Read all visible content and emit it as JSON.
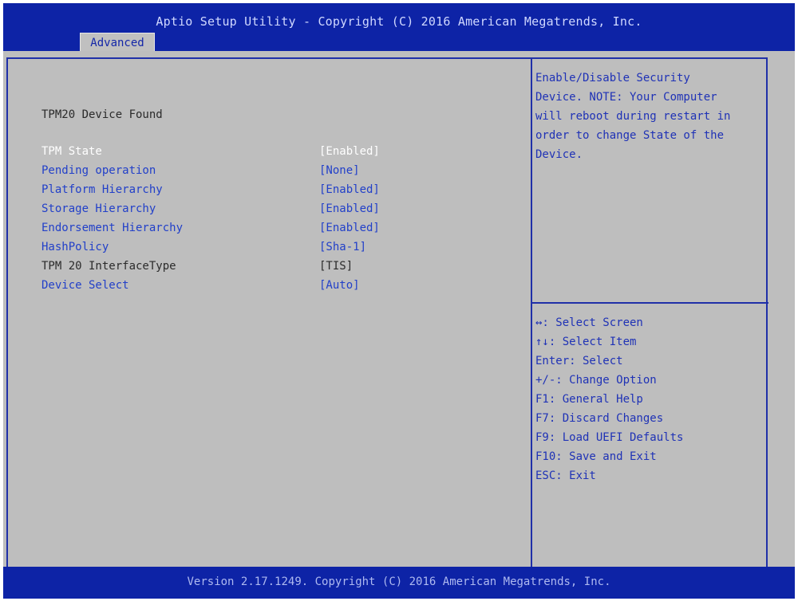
{
  "header": {
    "title": "Aptio Setup Utility - Copyright (C) 2016 American Megatrends, Inc.",
    "active_tab": "Advanced"
  },
  "main": {
    "section_title": "TPM20 Device Found",
    "settings": [
      {
        "label": "TPM State",
        "value": "[Enabled]"
      },
      {
        "label": "Pending operation",
        "value": "[None]"
      },
      {
        "label": "Platform Hierarchy",
        "value": "[Enabled]"
      },
      {
        "label": "Storage Hierarchy",
        "value": "[Enabled]"
      },
      {
        "label": "Endorsement Hierarchy",
        "value": "[Enabled]"
      },
      {
        "label": "HashPolicy",
        "value": "[Sha-1]"
      },
      {
        "label": "TPM 20 InterfaceType",
        "value": "[TIS]"
      },
      {
        "label": "Device Select",
        "value": "[Auto]"
      }
    ]
  },
  "help": {
    "text": "Enable/Disable Security\nDevice. NOTE: Your Computer\nwill reboot during restart in\norder to change State of the\nDevice."
  },
  "keys": [
    "↔: Select Screen",
    "↑↓: Select Item",
    "Enter: Select",
    "+/-: Change Option",
    "F1: General Help",
    "F7: Discard Changes",
    "F9: Load UEFI Defaults",
    "F10: Save and Exit",
    "ESC: Exit"
  ],
  "footer": {
    "text": "Version 2.17.1249. Copyright (C) 2016 American Megatrends, Inc."
  },
  "colors": {
    "header_bg": "#0d23a6",
    "panel_bg": "#bebebe",
    "selectable_text": "#2240c9",
    "static_text": "#2b2b2b",
    "selected_text": "#ffffff"
  }
}
